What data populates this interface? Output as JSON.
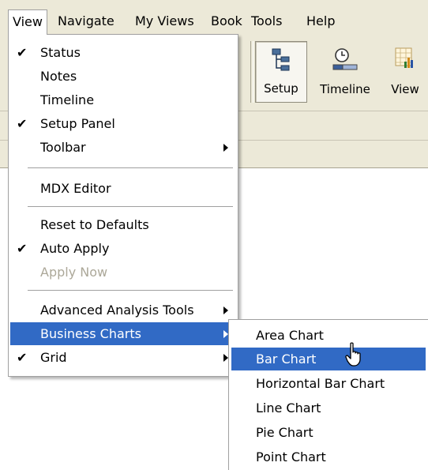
{
  "menubar": {
    "items": [
      "View",
      "Navigate",
      "My Views",
      "Book",
      "Tools",
      "Help"
    ],
    "open_item": "View"
  },
  "toolbar": {
    "buttons": [
      {
        "label": "Setup",
        "icon": "hierarchy-tree-icon",
        "pressed": true
      },
      {
        "label": "Timeline",
        "icon": "clock-timeline-icon",
        "pressed": false
      },
      {
        "label": "View",
        "icon": "chart-grid-icon",
        "pressed": false
      }
    ]
  },
  "view_menu": {
    "items": [
      {
        "label": "Status",
        "checked": true
      },
      {
        "label": "Notes",
        "checked": false
      },
      {
        "label": "Timeline",
        "checked": false
      },
      {
        "label": "Setup Panel",
        "checked": true
      },
      {
        "label": "Toolbar",
        "submenu": true
      },
      {
        "label": "MDX Editor"
      },
      {
        "label": "Reset to Defaults"
      },
      {
        "label": "Auto Apply",
        "checked": true
      },
      {
        "label": "Apply Now",
        "disabled": true
      },
      {
        "label": "Advanced Analysis Tools",
        "submenu": true
      },
      {
        "label": "Business Charts",
        "submenu": true,
        "highlighted": true
      },
      {
        "label": "Grid",
        "checked": true,
        "submenu": true
      }
    ]
  },
  "business_charts_submenu": {
    "items": [
      {
        "label": "Area Chart"
      },
      {
        "label": "Bar Chart",
        "highlighted": true
      },
      {
        "label": "Horizontal Bar Chart"
      },
      {
        "label": "Line Chart"
      },
      {
        "label": "Pie Chart"
      },
      {
        "label": "Point Chart"
      }
    ]
  },
  "colors": {
    "menu_highlight": "#316ac5",
    "chrome": "#ece9d8",
    "disabled_text": "#aca899"
  }
}
